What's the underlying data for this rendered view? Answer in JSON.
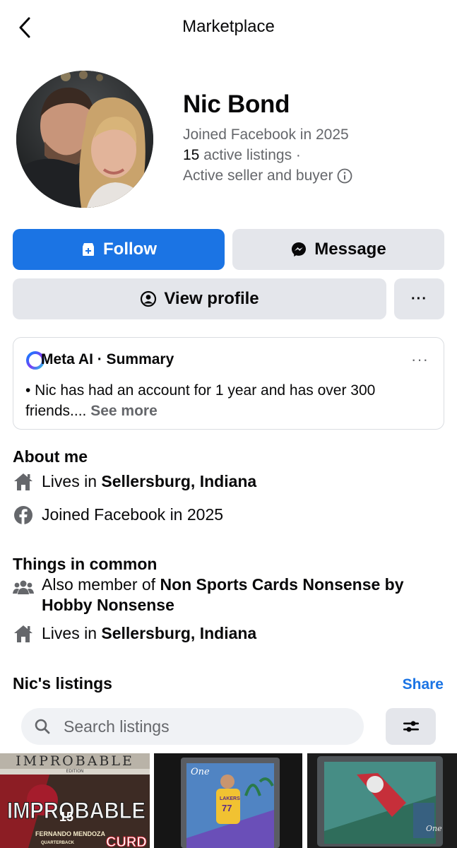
{
  "header": {
    "title": "Marketplace",
    "back_icon": "chevron-left-icon"
  },
  "profile": {
    "name": "Nic Bond",
    "joined": "Joined Facebook in 2025",
    "listings_count": "15",
    "listings_suffix": " active listings ·",
    "seller_type": "Active seller and buyer",
    "info_icon": "info-icon"
  },
  "actions": {
    "follow_label": "Follow",
    "message_label": "Message",
    "view_profile_label": "View profile",
    "more_label": "···"
  },
  "meta_ai": {
    "title": "Meta AI · Summary",
    "text": "• Nic has had an account for 1 year and has over 300 friends....",
    "see_more": "See more",
    "menu_label": "···"
  },
  "about": {
    "title": "About me",
    "lives_prefix": "Lives in ",
    "lives_location": "Sellersburg, Indiana",
    "joined": "Joined Facebook in 2025"
  },
  "common": {
    "title": "Things in common",
    "group_prefix": "Also member of ",
    "group_name": "Non Sports Cards Nonsense by Hobby Nonsense",
    "lives_prefix": "Lives in ",
    "lives_location": "Sellersburg, Indiana"
  },
  "listings": {
    "title": "Nic's listings",
    "share_label": "Share",
    "search_placeholder": "Search listings",
    "thumbnails": [
      {
        "top_text": "IMPROBABLE",
        "sub_text": "EDITION",
        "big_text": "IMPROBABLE",
        "number": "15",
        "player": "FERNANDO MENDOZA",
        "position": "QUARTERBACK",
        "corner_text": "CURD"
      },
      {
        "brand": "One",
        "team": "LAKERS",
        "number": "77"
      },
      {
        "brand": "One"
      }
    ]
  },
  "colors": {
    "accent": "#1b74e4",
    "button_grey": "#e4e6eb",
    "secondary_text": "#65676b"
  }
}
